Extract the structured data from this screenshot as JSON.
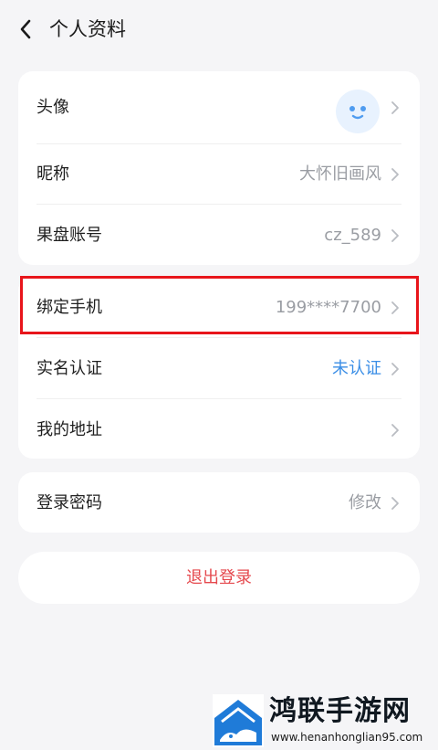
{
  "header": {
    "title": "个人资料",
    "back_icon": "chevron-left-icon"
  },
  "card1": {
    "rows": [
      {
        "label": "头像",
        "value": ""
      },
      {
        "label": "昵称",
        "value": "大怀旧画风"
      },
      {
        "label": "果盘账号",
        "value": "cz_589"
      }
    ]
  },
  "card2": {
    "rows": [
      {
        "label": "绑定手机",
        "value": "199****7700"
      },
      {
        "label": "实名认证",
        "value": "未认证"
      },
      {
        "label": "我的地址",
        "value": ""
      }
    ]
  },
  "card3": {
    "rows": [
      {
        "label": "登录密码",
        "value": "修改"
      }
    ]
  },
  "logout": {
    "label": "退出登录"
  },
  "watermark": {
    "title": "鸿联手游网",
    "url": "www.henanhonglian95.com"
  },
  "colors": {
    "background": "#f5f5f7",
    "accent_blue": "#3a8ee6",
    "logout_red": "#e5484d",
    "highlight_red": "#e8151b",
    "muted_text": "#9a9da3"
  }
}
